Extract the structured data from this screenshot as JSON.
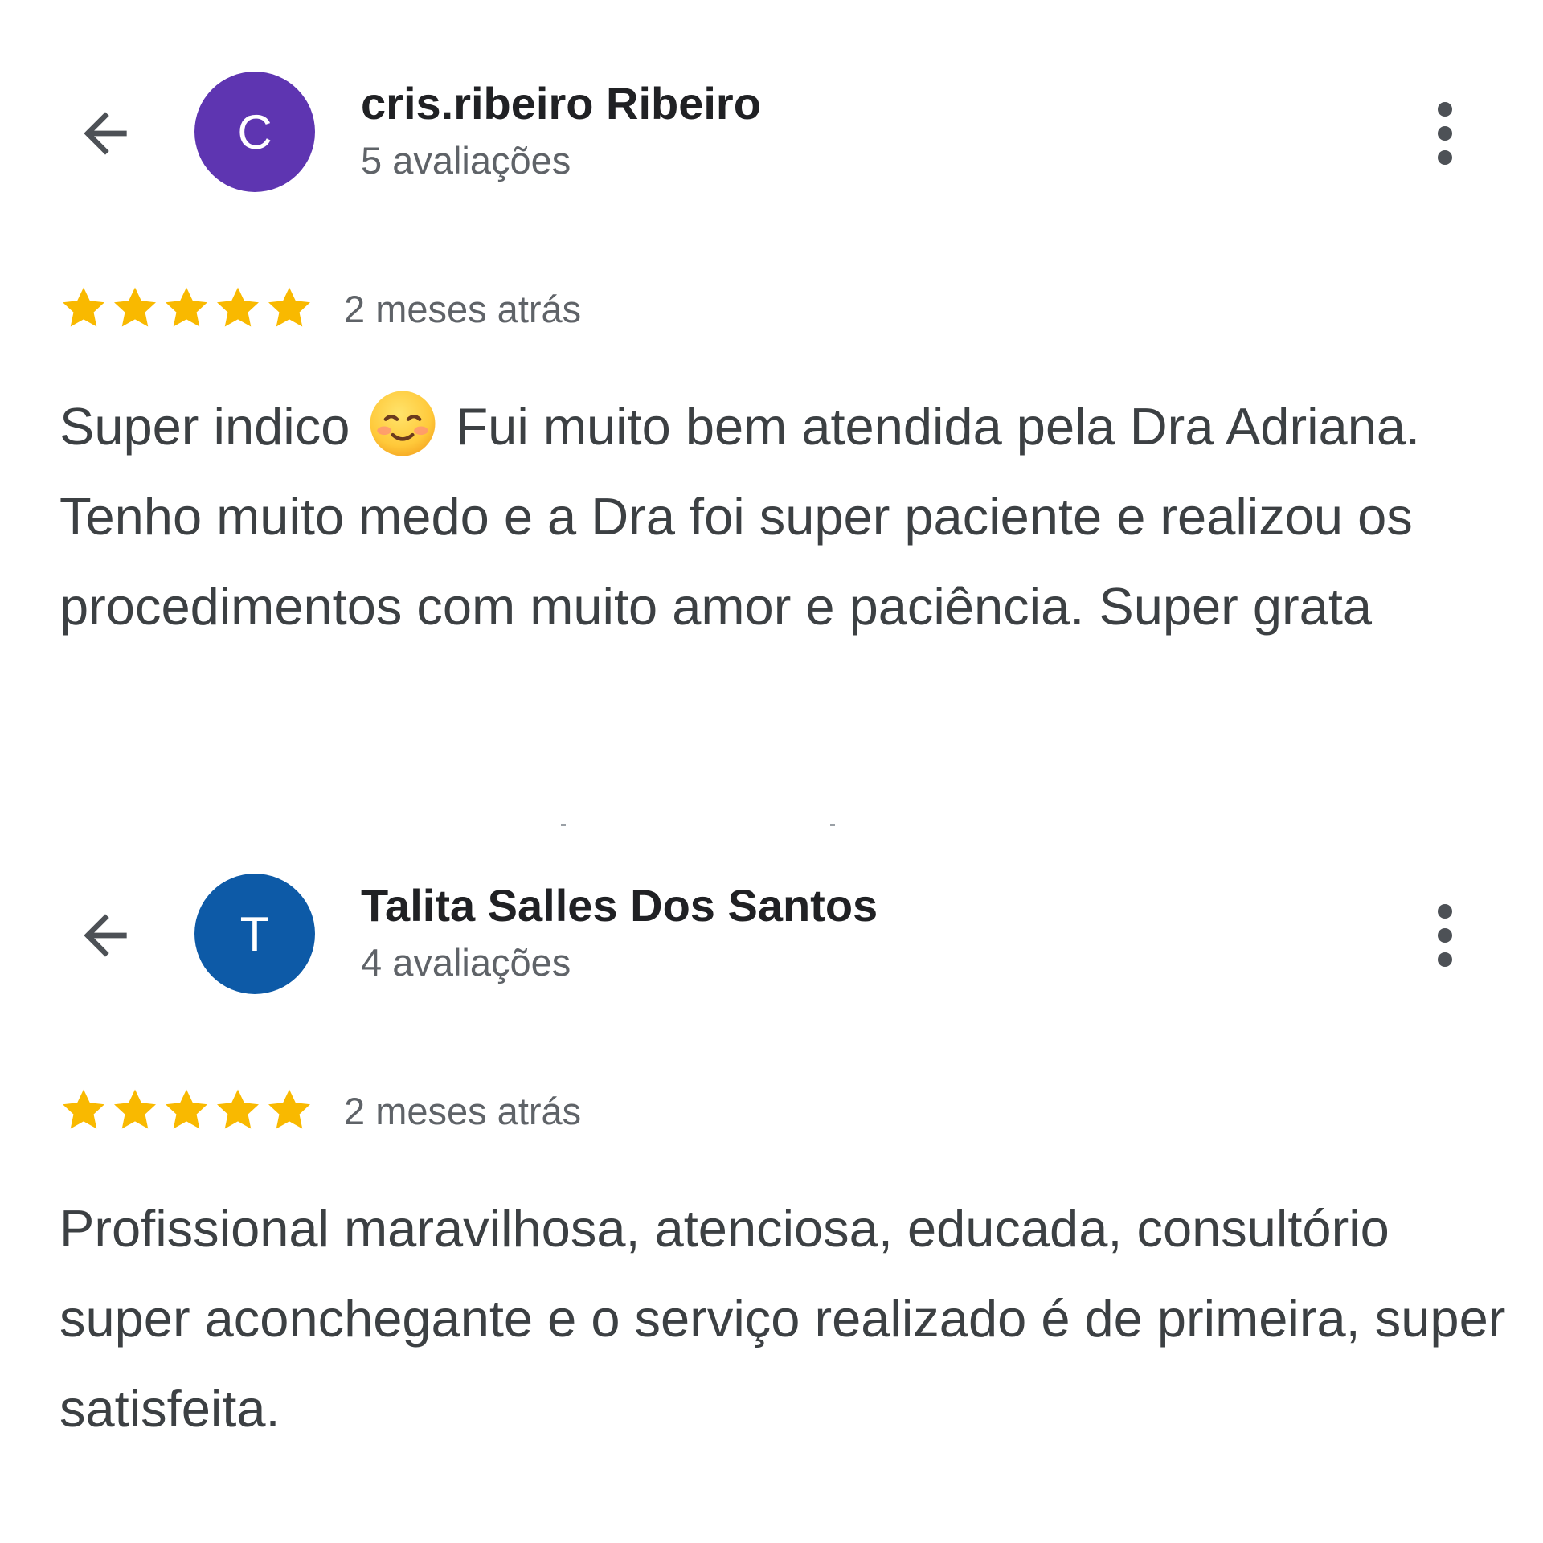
{
  "colors": {
    "star": "#F9B900",
    "name_text": "#202124",
    "secondary_text": "#5F6368",
    "body_text": "#3C4043",
    "icon": "#4D5156"
  },
  "reviews": [
    {
      "avatar_letter": "C",
      "avatar_color": "#5E35B1",
      "name": "cris.ribeiro Ribeiro",
      "count": "5 avaliações",
      "rating": 5,
      "time": "2 meses atrás",
      "text_before_emoji": "Super indico",
      "emoji": "smiling-face-with-smiling-eyes",
      "text_after_emoji": "Fui muito bem atendida pela Dra Adriana. Tenho muito medo e a Dra foi super paciente e realizou os procedimentos com muito amor e paciência. Super grata"
    },
    {
      "avatar_letter": "T",
      "avatar_color": "#0D5AA7",
      "name": "Talita Salles Dos Santos",
      "count": "4 avaliações",
      "rating": 5,
      "time": "2 meses atrás",
      "text": "Profissional maravilhosa, atenciosa, educada, consultório super aconchegante e o serviço realizado é de primeira, super satisfeita."
    }
  ]
}
